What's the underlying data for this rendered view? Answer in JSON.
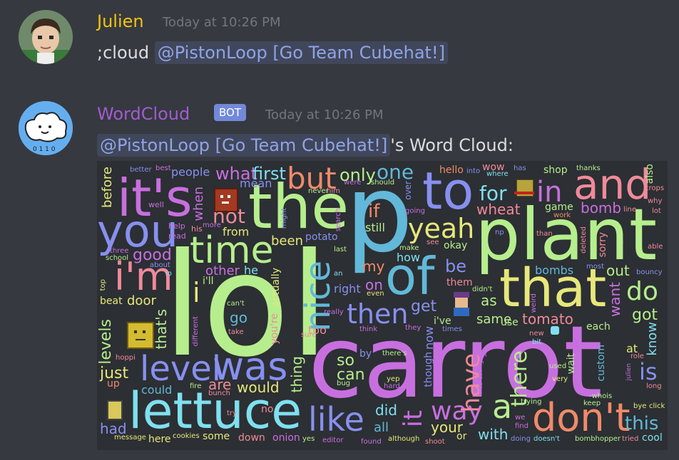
{
  "message1": {
    "author": "Julien",
    "timestamp": "Today at 10:26 PM",
    "command": ";cloud ",
    "mention": "@PistonLoop [Go Team Cubehat!]"
  },
  "message2": {
    "author": "WordCloud",
    "badge": "BOT",
    "timestamp": "Today at 10:26 PM",
    "mention": "@PistonLoop [Go Team Cubehat!]",
    "suffix": "'s Word Cloud:"
  },
  "colors": {
    "background": "#36393f",
    "julien_name": "#f1c40f",
    "wordcloud_name": "#a25bd0",
    "mention_text": "#8fa3e8",
    "bot_badge": "#7289da"
  },
  "cloud_words": {
    "lol": "lol",
    "carrot": "carrot",
    "p": "p",
    "plant": "plant",
    "the": "the",
    "that": "that",
    "its": "it's",
    "to": "to",
    "and": "and",
    "you": "you",
    "time": "time",
    "of": "of",
    "lettuce": "lettuce",
    "was": "was",
    "level": "level",
    "im": "i'm",
    "nice": "nice",
    "then": "then",
    "dont": "don't",
    "but": "but",
    "like": "like",
    "yeah": "yeah",
    "do": "do",
    "in": "in",
    "way": "way",
    "a": "a",
    "i": "i",
    "have": "have",
    "there": "there",
    "is": "is",
    "one": "one",
    "only": "only",
    "for": "for",
    "wheat": "wheat",
    "if": "if",
    "still": "still",
    "what": "what",
    "first": "first",
    "mean": "mean",
    "people": "people",
    "before": "before",
    "well": "well",
    "not": "not",
    "from": "from",
    "when": "when",
    "his": "his",
    "help": "help",
    "read": "read",
    "good": "good",
    "other": "other",
    "he": "he",
    "ill": "i'll",
    "actually": "actually",
    "door": "door",
    "beat": "beat",
    "levels": "levels",
    "thats": "that's",
    "just": "just",
    "up": "up",
    "go": "go",
    "youre": "you're",
    "too": "too",
    "could": "could",
    "are": "are",
    "would": "would",
    "thing": "thing",
    "so": "so",
    "can": "can",
    "by": "by",
    "did": "did",
    "all": "all",
    "it": "it",
    "your": "your",
    "or": "or",
    "with": "with",
    "had": "had",
    "here": "here",
    "some": "some",
    "down": "down",
    "onion": "onion",
    "this": "this",
    "cool": "cool",
    "bomb": "bomb",
    "game": "game",
    "shop": "shop",
    "out": "out",
    "want": "want",
    "got": "got",
    "know": "know",
    "each": "each",
    "at": "at",
    "custom": "custom",
    "tomato": "tomato",
    "same": "same",
    "ive": "i've",
    "get": "get",
    "as": "as",
    "be": "be",
    "my": "my",
    "on": "on",
    "right": "right",
    "been": "been",
    "potato": "potato",
    "okay": "okay",
    "how": "how",
    "now": "now",
    "though": "though",
    "bombs": "bombs",
    "hello": "hello",
    "wow": "wow",
    "also": "also",
    "sorry": "sorry",
    "wait": "wait",
    "use": "use",
    "them": "them",
    "three": "three",
    "school": "school",
    "better": "better",
    "best": "best",
    "never": "never",
    "him": "him",
    "were": "were",
    "should": "should",
    "over": "over",
    "going": "going",
    "might": "might",
    "search": "search",
    "last": "last",
    "an": "an",
    "even": "even",
    "make": "make",
    "see": "see",
    "didnt": "didn't",
    "weird": "weird",
    "really": "really",
    "sure": "sure",
    "think": "think",
    "they": "they",
    "times": "times",
    "new": "new",
    "bit": "bit",
    "used": "used",
    "very": "very",
    "into": "into",
    "where": "where",
    "has": "has",
    "thanks": "thanks",
    "work": "work",
    "line": "line",
    "why": "why",
    "crops": "crops",
    "lot": "lot",
    "able": "able",
    "bouncy": "bouncy",
    "most": "most",
    "deleted": "deleted",
    "than": "than",
    "np": "np",
    "about": "about",
    "io": "io",
    "top": "top",
    "cant": "can't",
    "take": "take",
    "different": "different",
    "more": "more",
    "fire": "fire",
    "bunch": "bunch",
    "try": "try",
    "no": "no",
    "theres": "there's",
    "yep": "yep",
    "hard": "hard",
    "bug": "bug",
    "interesting": "interesting",
    "oh": "oh",
    "trying": "trying",
    "we": "we",
    "find": "find",
    "doing": "doing",
    "doesnt": "doesn't",
    "bombhopper": "bombhopper",
    "tried": "tried",
    "keep": "keep",
    "whois": "-whois",
    "bye": "bye",
    "click": "click",
    "julien": "julien",
    "long": "long",
    "role": "role",
    "message": "message",
    "cookies": "cookies",
    "yes": "yes",
    "editor": "editor",
    "found": "found",
    "although": "although",
    "shoot": "shoot",
    "hoppi": "hoppi",
    "e": "e"
  }
}
